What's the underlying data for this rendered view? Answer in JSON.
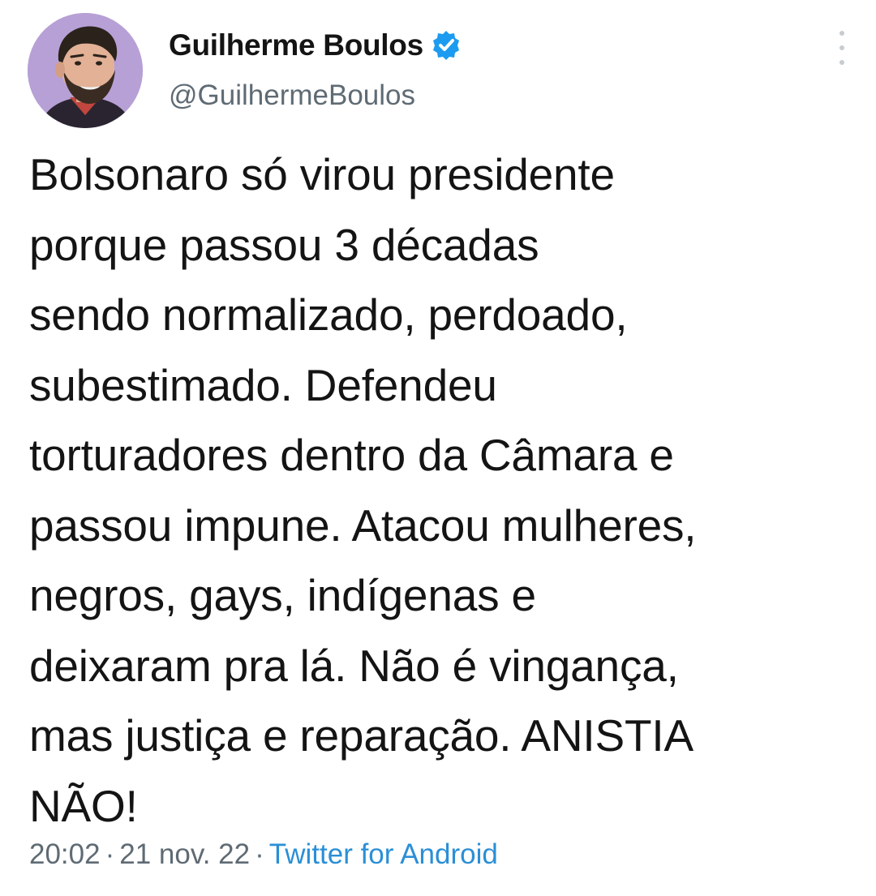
{
  "author": {
    "display_name": "Guilherme Boulos",
    "handle": "@GuilhermeBoulos",
    "verified": true,
    "avatar_icon": "profile-photo",
    "verified_icon": "verified-badge-icon",
    "verified_color": "#1d9bf0"
  },
  "tweet": {
    "lines": [
      "Bolsonaro só virou presidente",
      "porque passou 3 décadas",
      "sendo normalizado, perdoado,",
      "subestimado. Defendeu",
      "torturadores dentro da Câmara e",
      "passou impune. Atacou mulheres,",
      "negros, gays, indígenas e",
      "deixaram pra lá. Não é vingança,",
      "mas justiça e reparação. ANISTIA",
      "NÃO!"
    ]
  },
  "meta": {
    "time": "20:02",
    "date": "21 nov. 22",
    "separator": "·",
    "source": "Twitter for Android",
    "source_color": "#2b8fd6"
  }
}
